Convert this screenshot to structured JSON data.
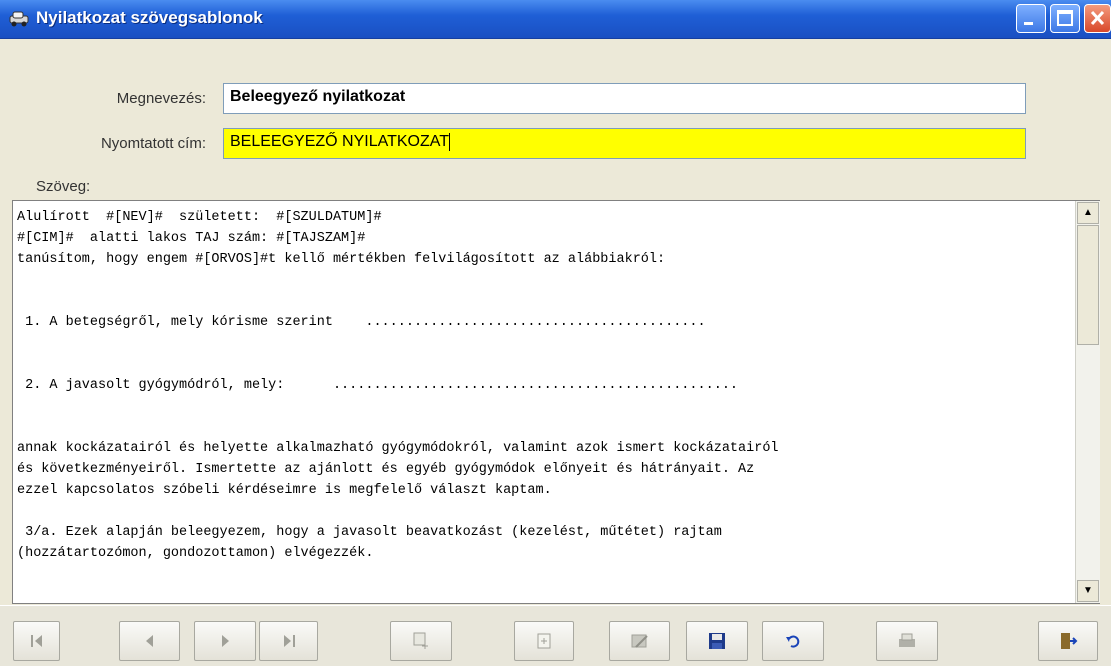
{
  "window": {
    "title": "Nyilatkozat szövegsablonok"
  },
  "form": {
    "name_label": "Megnevezés:",
    "name_value": "Beleegyező nyilatkozat",
    "print_title_label": "Nyomtatott cím:",
    "print_title_value": "BELEEGYEZŐ NYILATKOZAT",
    "text_label": "Szöveg:"
  },
  "text_lines": [
    "Alulírott  #[NEV]#  született:  #[SZULDATUM]#",
    "#[CIM]#  alatti lakos TAJ szám: #[TAJSZAM]#",
    "tanúsítom, hogy engem #[ORVOS]#t kellő mértékben felvilágosított az alábbiakról:",
    "",
    "",
    " 1. A betegségről, mely kórisme szerint    ..........................................",
    "",
    "",
    " 2. A javasolt gyógymódról, mely:      ..................................................",
    "",
    "",
    "annak kockázatairól és helyette alkalmazható gyógymódokról, valamint azok ismert kockázatairól",
    "és következményeiről. Ismertette az ajánlott és egyéb gyógymódok előnyeit és hátrányait. Az",
    "ezzel kapcsolatos szóbeli kérdéseimre is megfelelő választ kaptam.",
    "",
    " 3/a. Ezek alapján beleegyezem, hogy a javasolt beavatkozást (kezelést, műtétet) rajtam",
    "(hozzátartozómon, gondozottamon) elvégezzék."
  ],
  "toolbar": {
    "buttons": [
      "first-record",
      "previous-record",
      "next-record",
      "last-record",
      "new-record",
      "insert-record",
      "edit-record",
      "save-record",
      "undo",
      "print",
      "exit"
    ]
  }
}
